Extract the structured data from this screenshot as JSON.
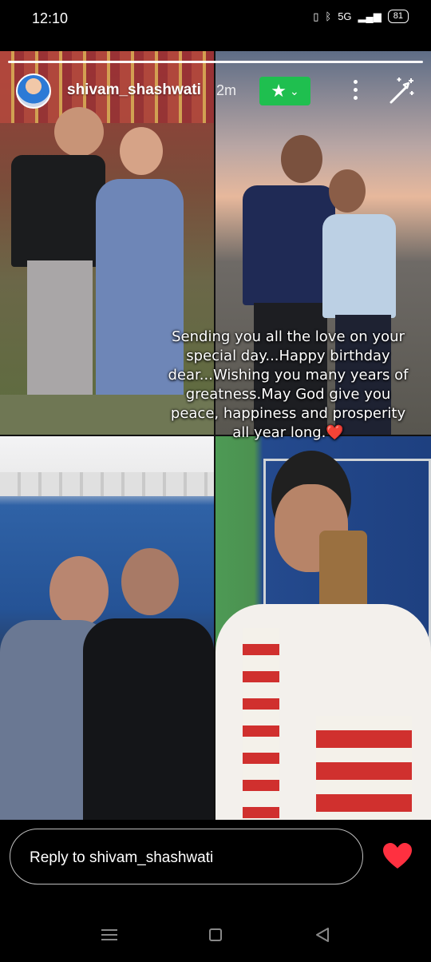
{
  "status_bar": {
    "time": "12:10",
    "network": "5G",
    "battery": "81"
  },
  "story": {
    "username": "shivam_shashwati",
    "time_ago": "2m",
    "close_friends_icon": "star-icon",
    "caption_lines": [
      "Sending you all the love on your",
      "special day...Happy birthday",
      "dear...Wishing you many years of",
      "greatness.May God give you",
      "peace, happiness and prosperity",
      "all year long."
    ],
    "caption_emoji": "❤️"
  },
  "reply": {
    "placeholder": "Reply to shivam_shashwati"
  },
  "colors": {
    "close_friends": "#1fbf4f",
    "like": "#ff3040"
  }
}
